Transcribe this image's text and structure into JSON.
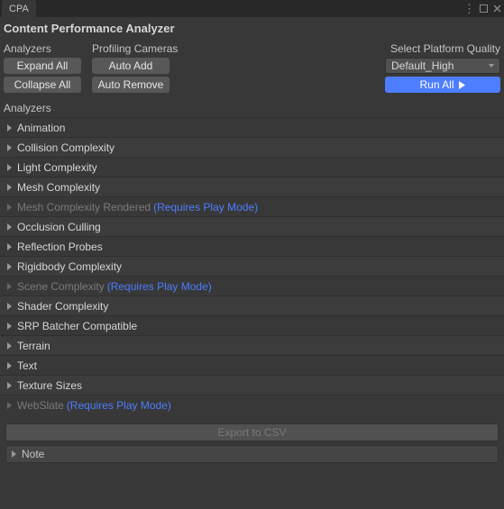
{
  "tab": {
    "title": "CPA"
  },
  "header": {
    "title": "Content Performance Analyzer"
  },
  "columns": {
    "analyzers_label": "Analyzers",
    "cameras_label": "Profiling Cameras"
  },
  "buttons": {
    "expand_all": "Expand All",
    "collapse_all": "Collapse All",
    "auto_add": "Auto Add",
    "auto_remove": "Auto Remove"
  },
  "platform": {
    "label": "Select Platform Quality",
    "selected": "Default_High",
    "run_label": "Run All"
  },
  "section_label": "Analyzers",
  "requires_play_mode": "(Requires Play Mode)",
  "analyzers": [
    {
      "label": "Animation",
      "disabled": false,
      "requires_play": false
    },
    {
      "label": "Collision Complexity",
      "disabled": false,
      "requires_play": false
    },
    {
      "label": "Light Complexity",
      "disabled": false,
      "requires_play": false
    },
    {
      "label": "Mesh Complexity",
      "disabled": false,
      "requires_play": false
    },
    {
      "label": "Mesh Complexity Rendered",
      "disabled": true,
      "requires_play": true
    },
    {
      "label": "Occlusion Culling",
      "disabled": false,
      "requires_play": false
    },
    {
      "label": "Reflection Probes",
      "disabled": false,
      "requires_play": false
    },
    {
      "label": "Rigidbody Complexity",
      "disabled": false,
      "requires_play": false
    },
    {
      "label": "Scene Complexity",
      "disabled": true,
      "requires_play": true
    },
    {
      "label": "Shader Complexity",
      "disabled": false,
      "requires_play": false
    },
    {
      "label": "SRP Batcher Compatible",
      "disabled": false,
      "requires_play": false
    },
    {
      "label": "Terrain",
      "disabled": false,
      "requires_play": false
    },
    {
      "label": "Text",
      "disabled": false,
      "requires_play": false
    },
    {
      "label": "Texture Sizes",
      "disabled": false,
      "requires_play": false
    },
    {
      "label": "WebSlate",
      "disabled": true,
      "requires_play": true
    }
  ],
  "export_label": "Export to CSV",
  "note_label": "Note"
}
